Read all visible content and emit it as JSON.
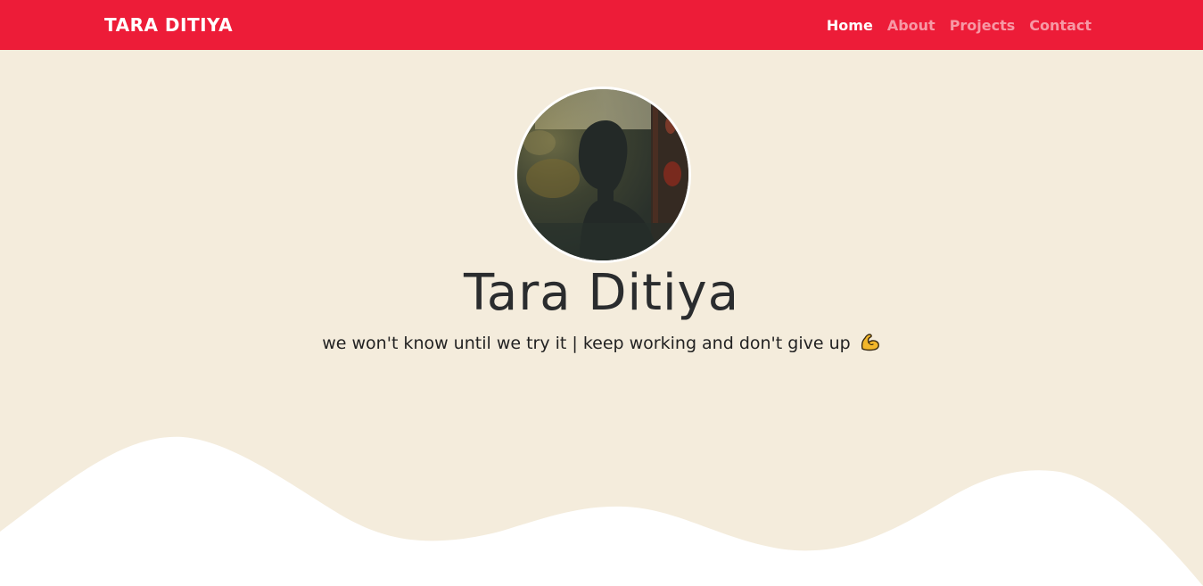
{
  "navbar": {
    "brand": "TARA DITIYA",
    "links": [
      {
        "label": "Home",
        "active": true
      },
      {
        "label": "About",
        "active": false
      },
      {
        "label": "Projects",
        "active": false
      },
      {
        "label": "Contact",
        "active": false
      }
    ]
  },
  "hero": {
    "avatar_icon": "profile-photo",
    "name": "Tara Ditiya",
    "tagline": "we won't know until we try it | keep working and don't give up",
    "tagline_icon": "flexed-biceps-icon"
  },
  "colors": {
    "navbar_bg": "#ed1c38",
    "page_bg": "#f4ecdc",
    "wave": "#ffffff",
    "text": "#2a2c2e"
  }
}
